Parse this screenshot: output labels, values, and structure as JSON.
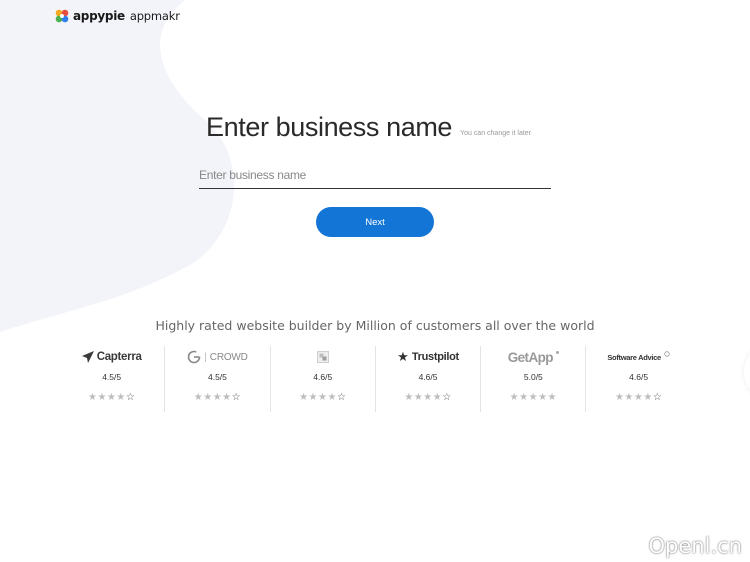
{
  "brand": {
    "name": "appypie",
    "product": "appmakr"
  },
  "form": {
    "heading": "Enter business name",
    "note": "You can change it later",
    "input_placeholder": "Enter business name",
    "input_value": "",
    "next_label": "Next",
    "accent_color": "#1376d6"
  },
  "ratings_section": {
    "tagline": "Highly rated website builder by Million of customers all over the world",
    "items": [
      {
        "name": "Capterra",
        "icon": "capterra-icon",
        "score": "4.5/5",
        "stars": "★★★★☆"
      },
      {
        "name": "CROWD",
        "icon": "g2-crowd-icon",
        "score": "4.5/5",
        "stars": "★★★★☆"
      },
      {
        "name": "",
        "icon": "review-site-icon",
        "score": "4.6/5",
        "stars": "★★★★☆"
      },
      {
        "name": "Trustpilot",
        "icon": "trustpilot-star-icon",
        "score": "4.6/5",
        "stars": "★★★★☆"
      },
      {
        "name": "GetApp",
        "icon": "getapp-icon",
        "score": "5.0/5",
        "stars": "★★★★★"
      },
      {
        "name": "Software Advice",
        "icon": "software-advice-icon",
        "score": "4.6/5",
        "stars": "★★★★☆"
      }
    ]
  },
  "watermark": "Openl.cn"
}
